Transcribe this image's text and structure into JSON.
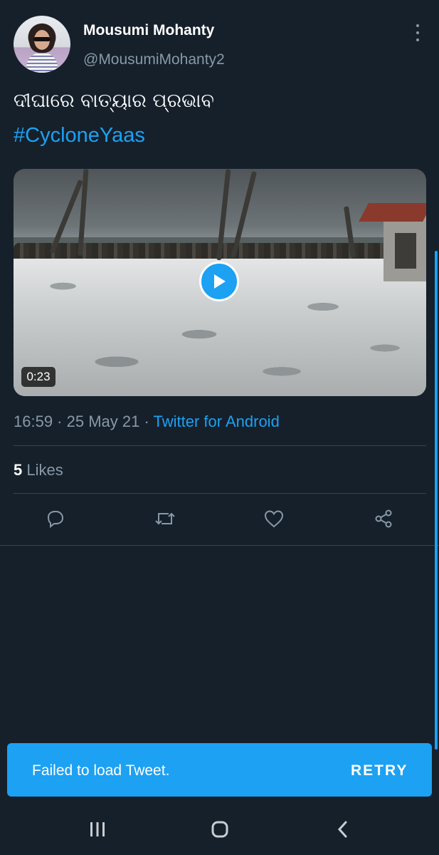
{
  "tweet": {
    "author_name": "Mousumi Mohanty",
    "author_handle": "@MousumiMohanty2",
    "text": "ଦୀଘାରେ ବାତ୍ୟାର ପ୍ରଭାବ",
    "hashtag": "#CycloneYaas",
    "video_duration": "0:23",
    "timestamp": "16:59 · 25 May 21",
    "separator": " · ",
    "source": "Twitter for Android",
    "likes_count": "5",
    "likes_label": " Likes"
  },
  "actions": [
    {
      "icon": "reply-icon"
    },
    {
      "icon": "retweet-icon"
    },
    {
      "icon": "like-icon"
    },
    {
      "icon": "share-icon"
    }
  ],
  "toast": {
    "message": "Failed to load Tweet.",
    "action_label": "RETRY"
  },
  "navbar": [
    {
      "icon": "recent-apps-icon"
    },
    {
      "icon": "home-icon"
    },
    {
      "icon": "back-icon"
    }
  ],
  "colors": {
    "background": "#15202b",
    "accent": "#1da1f2",
    "secondary_text": "#8899a6",
    "divider": "#38444d"
  }
}
